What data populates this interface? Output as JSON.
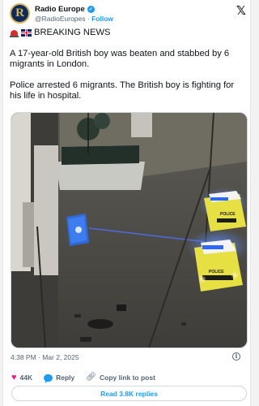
{
  "account": {
    "display_name": "Radio Europe",
    "handle": "@RadioEuropes",
    "separator": "·",
    "follow_label": "Follow",
    "avatar_letter": "R"
  },
  "post": {
    "headline": "BREAKING NEWS",
    "paragraph_1": "A 17-year-old British boy was beaten and stabbed by 6 migrants in London.",
    "paragraph_2": "Police arrested 6 migrants. The British boy is fighting for his life in hospital.",
    "timestamp": "4:38 PM · Mar 2, 2025"
  },
  "media": {
    "police_label": "POLICE"
  },
  "engagement": {
    "likes": "44K",
    "reply_label": "Reply",
    "copy_link_label": "Copy link to post",
    "read_replies_label": "Read 3.8K replies"
  },
  "icons": {
    "logo": "x-logo-icon",
    "verified": "verified-badge-icon",
    "like": "heart-icon",
    "reply": "reply-bubble-icon",
    "link": "link-icon",
    "info": "info-icon"
  },
  "colors": {
    "accent": "#1d9bf0",
    "like": "#f91880",
    "text": "#0f1419",
    "muted": "#536471"
  }
}
